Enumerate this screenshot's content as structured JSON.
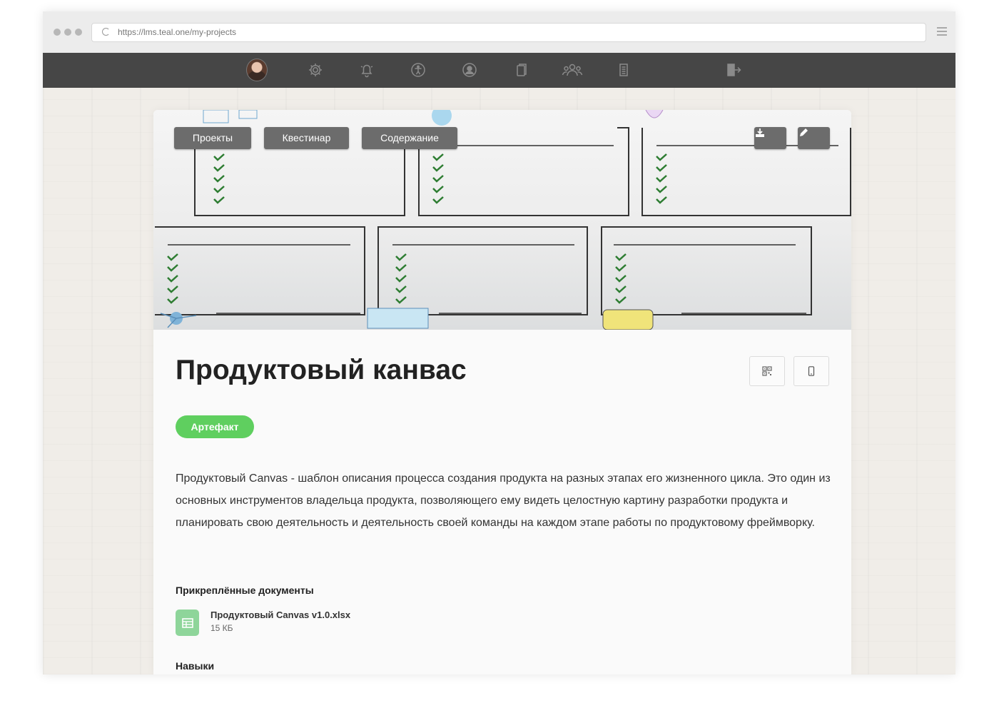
{
  "browser": {
    "url": "https://lms.teal.one/my-projects"
  },
  "nav": {
    "items": [
      {
        "name": "avatar"
      },
      {
        "name": "gear-icon"
      },
      {
        "name": "bell-icon"
      },
      {
        "name": "accessibility-icon"
      },
      {
        "name": "user-circle-icon"
      },
      {
        "name": "copy-icon"
      },
      {
        "name": "users-icon"
      },
      {
        "name": "document-icon"
      },
      {
        "name": "logout-icon"
      }
    ]
  },
  "hero": {
    "buttons": [
      "Проекты",
      "Квестинар",
      "Содержание"
    ],
    "actions": [
      "download-icon",
      "edit-icon"
    ]
  },
  "project": {
    "title": "Продуктовый канвас",
    "actions": [
      "qr-code-icon",
      "mobile-icon"
    ],
    "badge": "Артефакт",
    "description": "Продуктовый Canvas - шаблон описания процесса создания продукта на разных этапах его жизненного цикла. Это один из основных инструментов владельца продукта, позволяющего ему видеть целостную картину разработки продукта и планировать свою деятельность и деятельность своей команды на каждом этапе работы по продуктовому фреймворку.",
    "attachments_heading": "Прикреплённые документы",
    "attachments": [
      {
        "name": "Продуктовый Canvas v1.0.xlsx",
        "size": "15 КБ",
        "icon": "spreadsheet-icon"
      }
    ],
    "skills_heading": "Навыки"
  },
  "colors": {
    "nav_bg": "#464646",
    "pill_bg": "#6c6c6c",
    "badge_bg": "#5fcf5f",
    "file_icon_bg": "#8ed59a"
  }
}
